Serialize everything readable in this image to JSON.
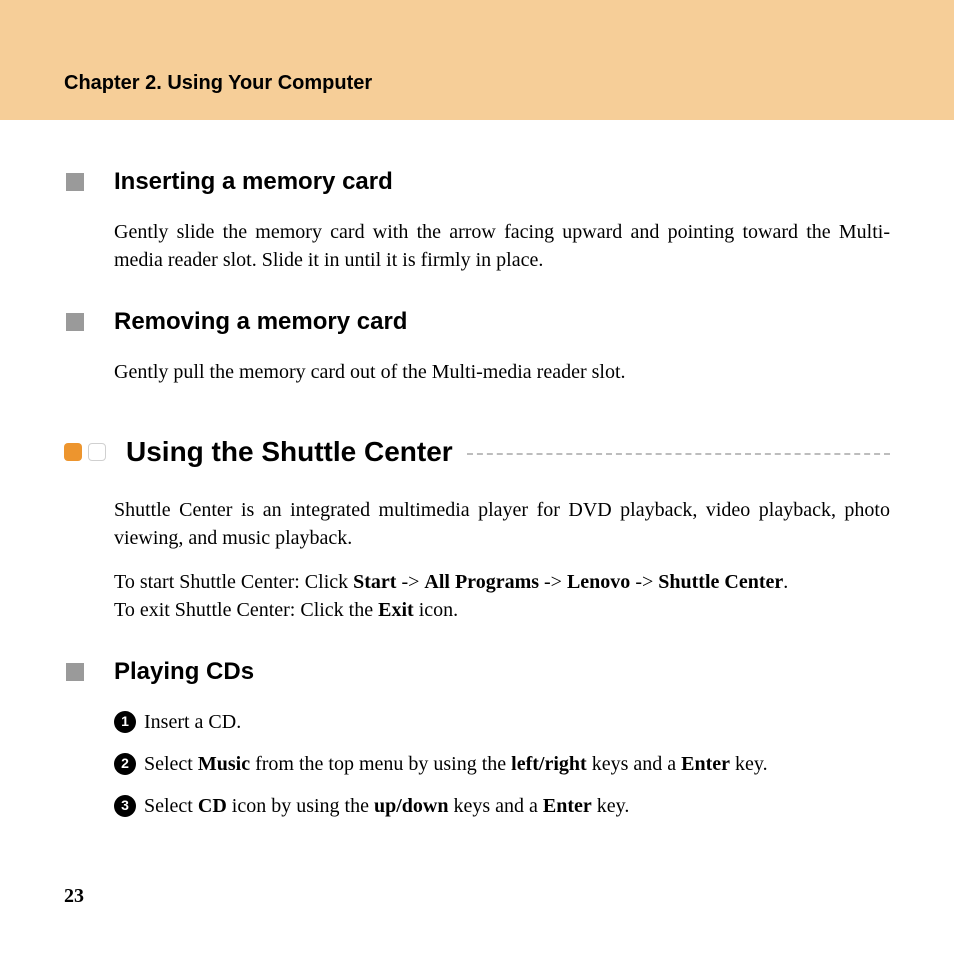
{
  "header": {
    "chapter_title": "Chapter 2. Using Your Computer"
  },
  "sections": {
    "inserting": {
      "heading": "Inserting a memory card",
      "body": "Gently slide the memory card with the arrow facing upward and pointing toward the Multi-media reader slot. Slide it in until it is firmly in place."
    },
    "removing": {
      "heading": "Removing a memory card",
      "body": "Gently pull the memory card out of the Multi-media reader slot."
    },
    "shuttle": {
      "heading": "Using the Shuttle Center",
      "intro": "Shuttle Center is an integrated multimedia player for DVD playback, video playback, photo viewing, and music playback.",
      "start_pre": "To start Shuttle Center: Click ",
      "start_b1": "Start",
      "arrow": " -> ",
      "start_b2": "All Programs",
      "start_b3": "Lenovo",
      "start_b4": "Shuttle Center",
      "period": ".",
      "exit_pre": "To exit Shuttle Center: Click the ",
      "exit_b": "Exit",
      "exit_post": " icon."
    },
    "playing_cds": {
      "heading": "Playing CDs",
      "steps": {
        "s1_num": "1",
        "s1_text": "Insert a CD.",
        "s2_num": "2",
        "s2_pre": "Select ",
        "s2_b1": "Music",
        "s2_mid1": " from the top menu by using the ",
        "s2_b2": "left/right",
        "s2_mid2": " keys and a ",
        "s2_b3": "Enter",
        "s2_post": " key.",
        "s3_num": "3",
        "s3_pre": "Select ",
        "s3_b1": "CD",
        "s3_mid1": " icon by using the ",
        "s3_b2": "up/down",
        "s3_mid2": " keys and a ",
        "s3_b3": "Enter",
        "s3_post": " key."
      }
    }
  },
  "page_number": "23"
}
